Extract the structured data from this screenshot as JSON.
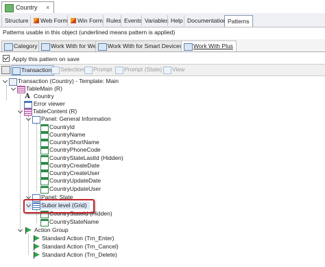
{
  "window": {
    "tab_title": "Country",
    "close_glyph": "×"
  },
  "object_tabs": [
    {
      "label": "Structure"
    },
    {
      "label": "Web Form"
    },
    {
      "label": "Win Form"
    },
    {
      "label": "Rules"
    },
    {
      "label": "Events"
    },
    {
      "label": "Variables"
    },
    {
      "label": "Help"
    },
    {
      "label": "Documentation"
    },
    {
      "label": "Patterns"
    }
  ],
  "patterns_info": "Patterns usable in this object (underlined means pattern is applied)",
  "pattern_tabs": [
    {
      "label": "Category"
    },
    {
      "label": "Work With for Web"
    },
    {
      "label": "Work With for Smart Devices"
    },
    {
      "label": "Work With Plus"
    }
  ],
  "apply_on_save": {
    "label": "Apply this pattern on save",
    "checked": true
  },
  "toolbar": [
    {
      "label": "Transaction"
    },
    {
      "label": "Selection"
    },
    {
      "label": "Prompt"
    },
    {
      "label": "Prompt (State)"
    },
    {
      "label": "View"
    }
  ],
  "tree": [
    {
      "label": "Transaction (Country) - Template: Main",
      "icon": "transaction-icon"
    },
    {
      "label": "TableMain (R)",
      "icon": "table-icon"
    },
    {
      "label": "Country",
      "icon": "text-a-icon"
    },
    {
      "label": "Error viewer",
      "icon": "error-viewer-icon"
    },
    {
      "label": "TableContent (R)",
      "icon": "table-icon"
    },
    {
      "label": "Panel: General Information",
      "icon": "panel-icon"
    },
    {
      "label": "CountryId",
      "icon": "attribute-icon"
    },
    {
      "label": "CountryName",
      "icon": "attribute-icon"
    },
    {
      "label": "CountryShortName",
      "icon": "attribute-icon"
    },
    {
      "label": "CountryPhoneCode",
      "icon": "attribute-icon"
    },
    {
      "label": "CountryStateLastId (Hidden)",
      "icon": "attribute-icon"
    },
    {
      "label": "CountryCreateDate",
      "icon": "attribute-icon"
    },
    {
      "label": "CountryCreateUser",
      "icon": "attribute-icon"
    },
    {
      "label": "CountryUpdateDate",
      "icon": "attribute-icon"
    },
    {
      "label": "CountryUpdateUser",
      "icon": "attribute-icon"
    },
    {
      "label": "Panel: State",
      "icon": "panel-icon"
    },
    {
      "label": "Subor level (Grid)",
      "icon": "grid-icon"
    },
    {
      "label": "CountryStateId (Hidden)",
      "icon": "attribute-icon"
    },
    {
      "label": "CountryStateName",
      "icon": "attribute-icon"
    },
    {
      "label": "Action Group",
      "icon": "flag-icon"
    },
    {
      "label": "Standard Action (Trn_Enter)",
      "icon": "flag-icon"
    },
    {
      "label": "Standard Action (Trn_Cancel)",
      "icon": "flag-icon"
    },
    {
      "label": "Standard Action (Trn_Delete)",
      "icon": "flag-icon"
    }
  ],
  "colors": {
    "highlight_border": "#c2232b",
    "accent_blue": "#4a79b5",
    "attribute_green": "#2f8a48"
  }
}
